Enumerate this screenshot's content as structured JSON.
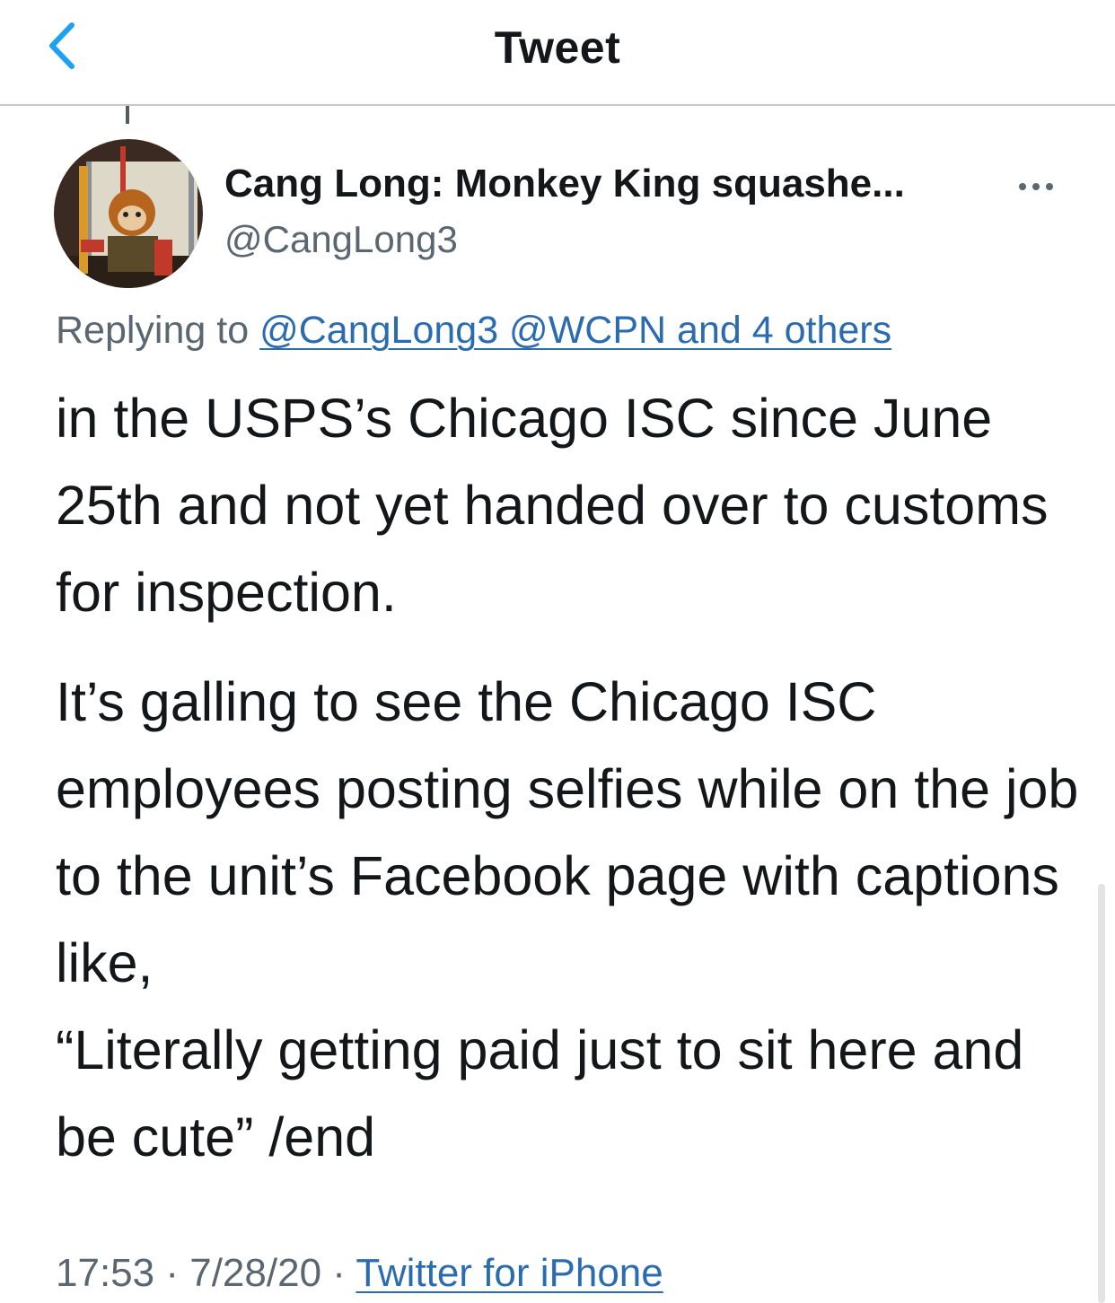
{
  "navbar": {
    "title": "Tweet",
    "back_icon": "chevron-left-icon"
  },
  "tweet": {
    "display_name": "Cang Long: Monkey King squashe...",
    "handle": "@CangLong3",
    "more_icon": "ellipsis-icon",
    "replying_prefix": "Replying to",
    "replying_links": "@CangLong3 @WCPN and 4 others",
    "paragraphs": [
      "in the USPS’s Chicago ISC since June 25th and not yet handed over to customs for inspection.",
      "It’s galling to see the Chicago ISC employees posting selfies while on the job to the unit’s Facebook page with captions like,\n“Literally getting paid just to sit here and be cute” /end"
    ],
    "time": "17:53",
    "date": "7/28/20",
    "separator": "·",
    "source": "Twitter for iPhone"
  },
  "colors": {
    "accent": "#1da1f2",
    "link": "#2b6cb0",
    "text": "#14171a",
    "secondary": "#5b6770"
  }
}
